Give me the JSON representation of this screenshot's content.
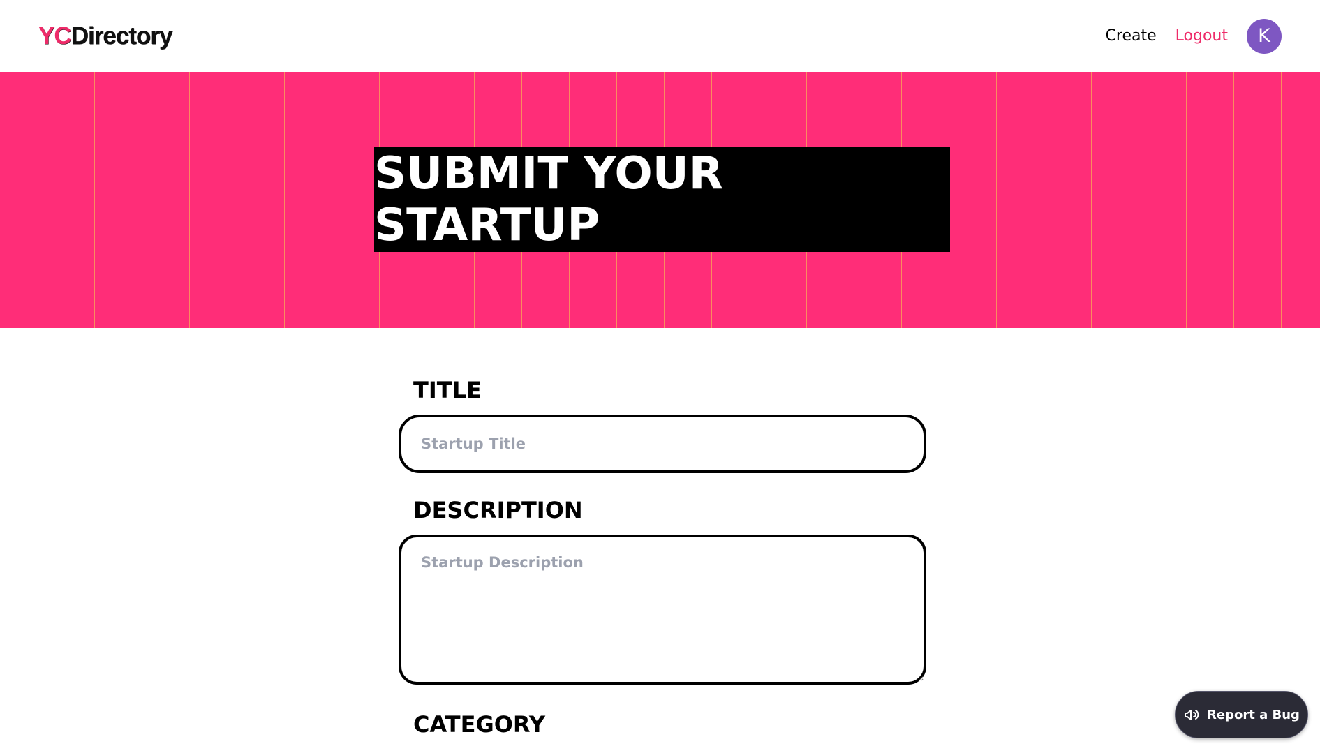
{
  "navbar": {
    "logo_prefix": "YC",
    "logo_suffix": "Directory",
    "create_label": "Create",
    "logout_label": "Logout",
    "avatar_initial": "K"
  },
  "hero": {
    "heading": "SUBMIT YOUR STARTUP"
  },
  "form": {
    "title_label": "TITLE",
    "title_placeholder": "Startup Title",
    "description_label": "DESCRIPTION",
    "description_placeholder": "Startup Description",
    "category_label": "CATEGORY"
  },
  "bug_report": {
    "label": "Report a Bug",
    "icon": "megaphone-icon"
  },
  "colors": {
    "brand_pink": "#EE2B69",
    "hero_bg": "#FF2D78",
    "avatar_bg": "#7E57C2",
    "bug_button_bg": "#2B2B36"
  }
}
